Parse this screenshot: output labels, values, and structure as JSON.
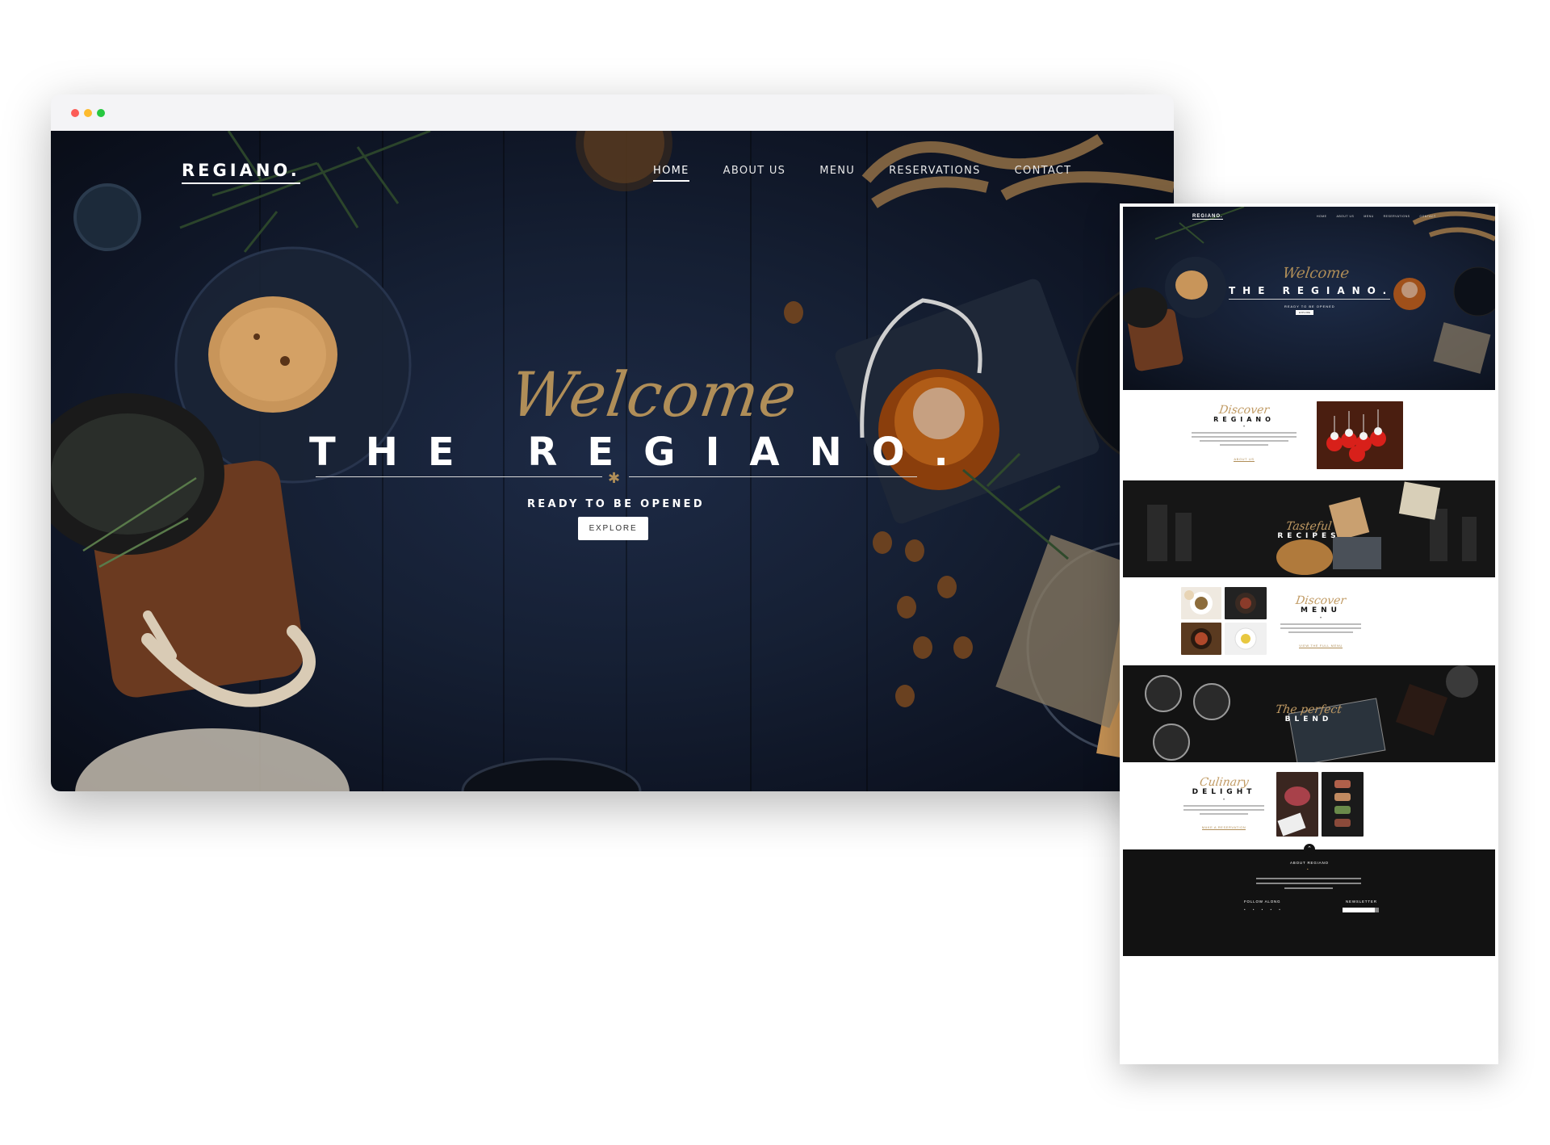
{
  "site": {
    "logo": "REGIANO.",
    "nav": [
      "HOME",
      "ABOUT US",
      "MENU",
      "RESERVATIONS",
      "CONTACT"
    ],
    "active_nav": "HOME"
  },
  "hero": {
    "script_title": "Welcome",
    "title": "THE REGIANO.",
    "subtitle": "READY TO BE OPENED",
    "cta": "EXPLORE"
  },
  "preview": {
    "logo": "REGIANO.",
    "nav": [
      "HOME",
      "ABOUT US",
      "MENU",
      "RESERVATIONS",
      "CONTACT"
    ],
    "hero": {
      "script_title": "Welcome",
      "title": "THE REGIANO.",
      "subtitle": "READY TO BE OPENED",
      "cta": "EXPLORE"
    },
    "about": {
      "script": "Discover",
      "title": "REGIANO",
      "link": "ABOUT US"
    },
    "recipes": {
      "script": "Tasteful",
      "title": "RECIPES"
    },
    "menu": {
      "script": "Discover",
      "title": "MENU",
      "link": "VIEW THE FULL MENU"
    },
    "blend": {
      "script": "The perfect",
      "title": "BLEND"
    },
    "delight": {
      "script": "Culinary",
      "title": "DELIGHT",
      "link": "MAKE A RESERVATION"
    },
    "footer": {
      "about_title": "ABOUT REGIANO",
      "follow_title": "FOLLOW ALONG",
      "newsletter_title": "NEWSLETTER"
    }
  },
  "colors": {
    "accent_gold": "#b08e58",
    "hero_navy": "#151f33",
    "footer_black": "#121212"
  }
}
